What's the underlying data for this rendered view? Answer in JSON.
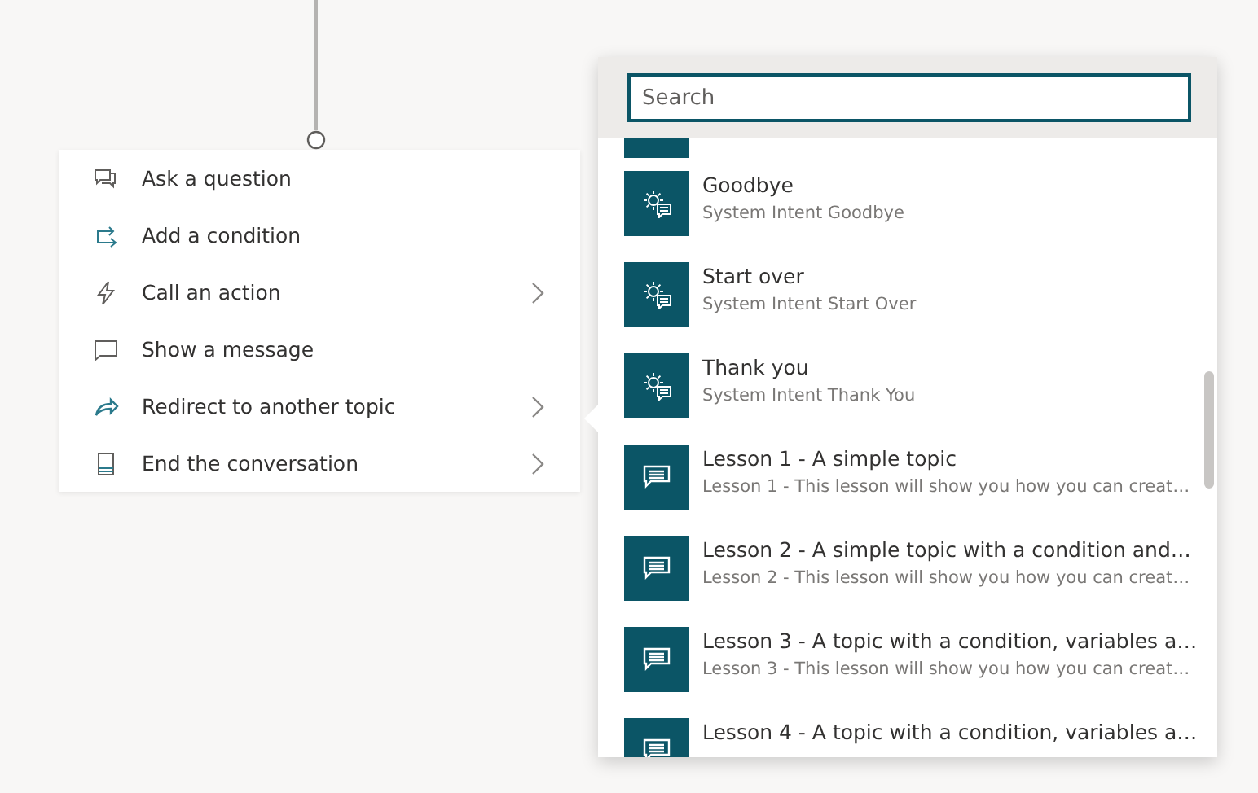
{
  "menu": {
    "items": [
      {
        "label": "Ask a question",
        "has_submenu": false
      },
      {
        "label": "Add a condition",
        "has_submenu": false
      },
      {
        "label": "Call an action",
        "has_submenu": true
      },
      {
        "label": "Show a message",
        "has_submenu": false
      },
      {
        "label": "Redirect to another topic",
        "has_submenu": true
      },
      {
        "label": "End the conversation",
        "has_submenu": true
      }
    ]
  },
  "topic_picker": {
    "search": {
      "placeholder": "Search"
    },
    "topics": [
      {
        "kind": "system",
        "title": "Goodbye",
        "subtitle": "System Intent Goodbye"
      },
      {
        "kind": "system",
        "title": "Start over",
        "subtitle": "System Intent Start Over"
      },
      {
        "kind": "system",
        "title": "Thank you",
        "subtitle": "System Intent Thank You"
      },
      {
        "kind": "lesson",
        "title": "Lesson 1 - A simple topic",
        "subtitle": "Lesson 1 - This lesson will show you how you can creat…"
      },
      {
        "kind": "lesson",
        "title": "Lesson 2 - A simple topic with a condition and…",
        "subtitle": "Lesson 2 - This lesson will show you how you can creat…"
      },
      {
        "kind": "lesson",
        "title": "Lesson 3 - A topic with a condition, variables a…",
        "subtitle": "Lesson 3 - This lesson will show you how you can creat…"
      },
      {
        "kind": "lesson",
        "title": "Lesson 4 - A topic with a condition, variables a…"
      }
    ]
  }
}
